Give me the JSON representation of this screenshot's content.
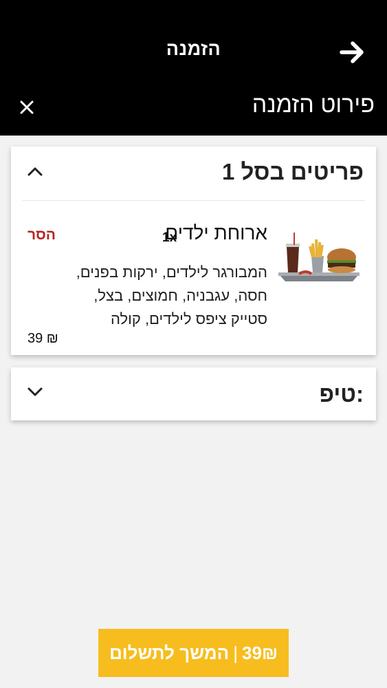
{
  "header": {
    "title": "הזמנה",
    "section_title": "פירוט הזמנה"
  },
  "basket": {
    "title": "1 פריטים בסל",
    "item": {
      "name": "ארוחת ילדים",
      "qty": "1x",
      "description": "המבורגר לילדים, ירקות בפנים, חסה, עגבניה, חמוצים, בצל, סטייק ציפס לילדים, קולה",
      "remove_label": "הסר",
      "price": "39 ₪"
    }
  },
  "tip": {
    "title": "טיפ:"
  },
  "footer": {
    "pay_label": "המשך לתשלום",
    "pay_amount": "39₪"
  },
  "colors": {
    "header_bg": "#000000",
    "accent_button": "#f7bd1f",
    "remove_red": "#b3271f"
  },
  "icons": [
    "arrow-right-icon",
    "close-icon",
    "chevron-up-icon",
    "chevron-down-icon"
  ]
}
